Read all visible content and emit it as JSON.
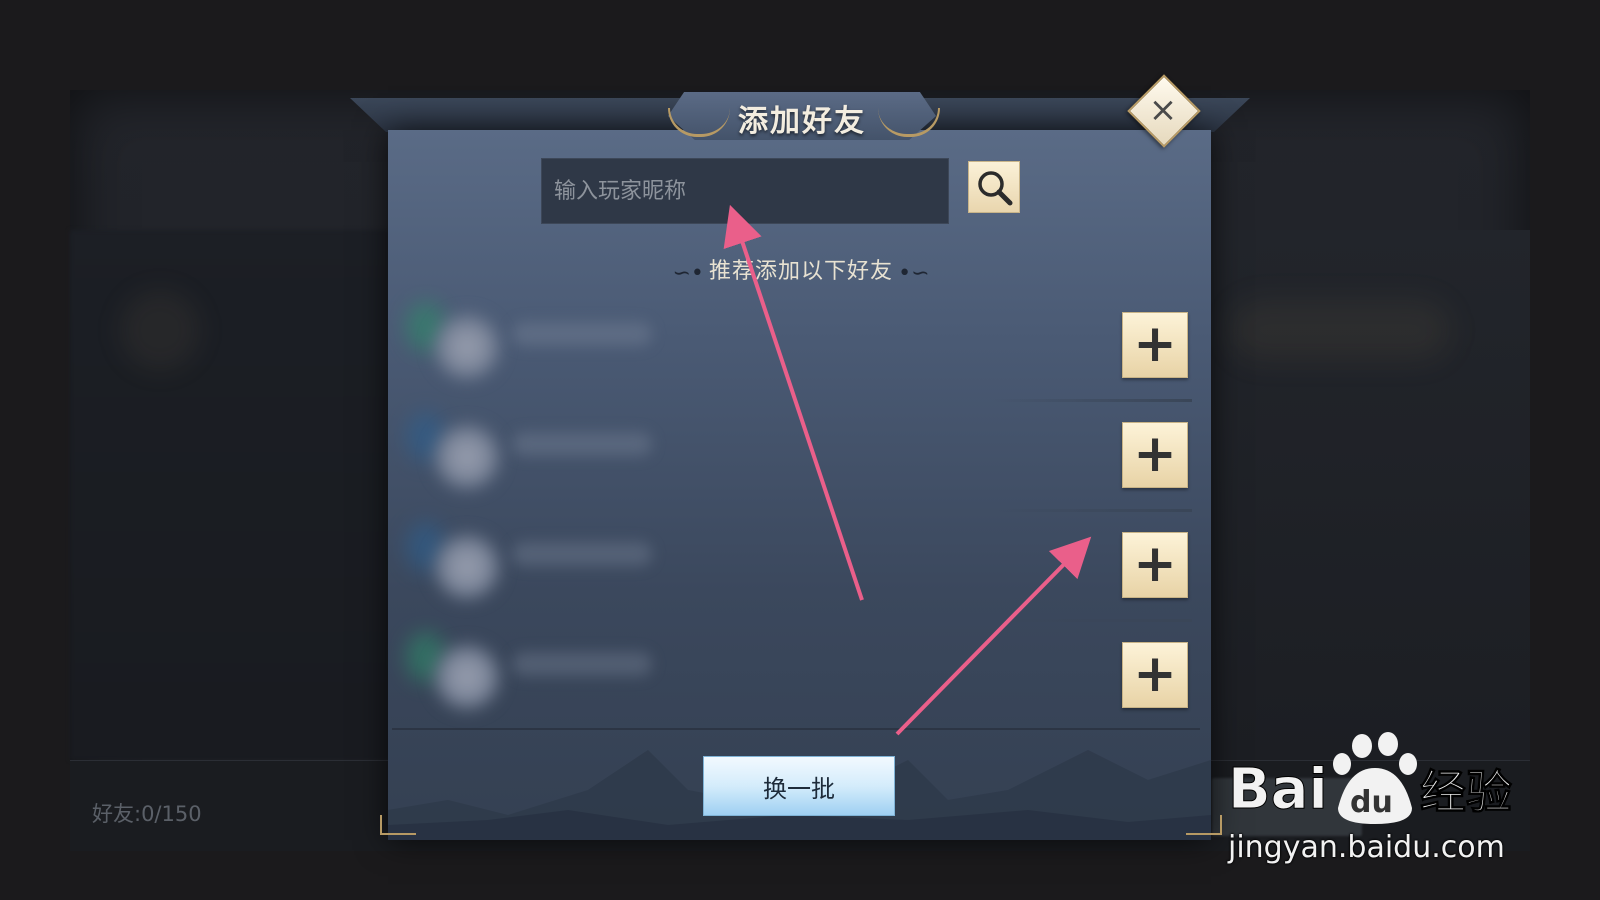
{
  "background": {
    "friend_count": "好友:0/150"
  },
  "dialog": {
    "title": "添加好友",
    "close_icon": "×",
    "search": {
      "placeholder": "输入玩家昵称",
      "icon": "magnifier-icon"
    },
    "recommend_label": "推荐添加以下好友",
    "rows": [
      {
        "add_icon": "+"
      },
      {
        "add_icon": "+"
      },
      {
        "add_icon": "+"
      },
      {
        "add_icon": "+"
      }
    ],
    "refresh_label": "换一批"
  },
  "watermark": {
    "brand": "Baidu经验",
    "url": "jingyan.baidu.com"
  },
  "colors": {
    "arrow": "#ea5f8a",
    "button_gold": "#e8d3a6",
    "refresh_blue": "#9fd0f2"
  }
}
